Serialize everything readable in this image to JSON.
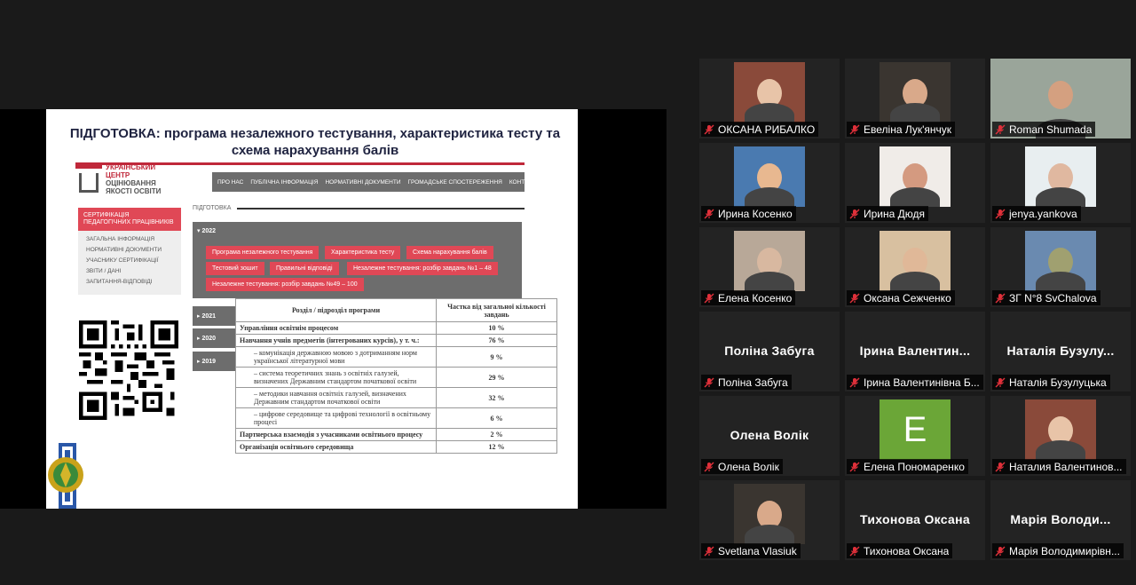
{
  "slide": {
    "title": "ПІДГОТОВКА: програма незалежного тестування, характеристика тесту та схема нарахування балів",
    "logo_lines": [
      "УКРАЇНСЬКИЙ",
      "ЦЕНТР",
      "ОЦІНЮВАННЯ",
      "ЯКОСТІ ОСВІТИ"
    ],
    "nav": [
      "ПРО НАС",
      "ПУБЛІЧНА ІНФОРМАЦІЯ",
      "НОРМАТИВНІ ДОКУМЕНТИ",
      "ГРОМАДСЬКЕ СПОСТЕРЕЖЕННЯ",
      "КОНТАКТИ"
    ],
    "left_menu_active": "СЕРТИФІКАЦІЯ ПЕДАГОГІЧНИХ ПРАЦІВНИКІВ",
    "left_menu_items": [
      "ЗАГАЛЬНА ІНФОРМАЦІЯ",
      "НОРМАТИВНІ ДОКУМЕНТИ",
      "УЧАСНИКУ СЕРТИФІКАЦІЇ",
      "ЗВІТИ / ДАНІ",
      "ЗАПИТАННЯ-ВІДПОВІДІ"
    ],
    "breadcrumb": "ПІДГОТОВКА",
    "year_open": "2022",
    "buttons": [
      "Програма незалежного тестування",
      "Характеристика тесту",
      "Схема нарахування балів",
      "Тестовий зошит",
      "Правильні відповіді",
      "Незалежне тестування: розбір завдань №1 – 48",
      "Незалежне тестування: розбір завдань №49 – 100"
    ],
    "years_closed": [
      "2021",
      "2020",
      "2019"
    ],
    "table": {
      "headers": [
        "Розділ / підрозділ програми",
        "Частка від загальної кількості завдань"
      ],
      "rows": [
        {
          "label": "Управління освітнім процесом",
          "value": "10 %",
          "style": "b"
        },
        {
          "label": "Навчання учнів предметів (інтегрованих курсів), у т. ч.:",
          "value": "76 %",
          "style": "b"
        },
        {
          "label": "– комунікація державною мовою з дотриманням норм української літературної мови",
          "value": "9 %",
          "style": "sub"
        },
        {
          "label": "– система теоретичних знань з освітніх галузей, визначених Державним стандартом початкової освіти",
          "value": "29 %",
          "style": "sub"
        },
        {
          "label": "– методики навчання освітніх галузей, визначених Державним стандартом початкової освіти",
          "value": "32 %",
          "style": "sub"
        },
        {
          "label": "– цифрове середовище та цифрові технології в освітньому процесі",
          "value": "6 %",
          "style": "sub"
        },
        {
          "label": "Партнерська взаємодія з учасниками освітнього процесу",
          "value": "2 %",
          "style": "b"
        },
        {
          "label": "Організація освітнього середовища",
          "value": "12 %",
          "style": "b"
        }
      ]
    }
  },
  "participants": [
    {
      "name": "ОКСАНА РИБАЛКО",
      "type": "video"
    },
    {
      "name": "Евеліна Лук'янчук",
      "type": "video"
    },
    {
      "name": "Roman Shumada",
      "type": "video",
      "active": true
    },
    {
      "name": "Ирина Косенко",
      "type": "video"
    },
    {
      "name": "Ирина Дюдя",
      "type": "video"
    },
    {
      "name": "jenya.yankova",
      "type": "video"
    },
    {
      "name": "Елена Косенко",
      "type": "video"
    },
    {
      "name": "Оксана Сежченко",
      "type": "video"
    },
    {
      "name": "ЗГ N°8 SvChalova",
      "type": "video"
    },
    {
      "name": "Поліна Забуга",
      "type": "name",
      "big": "Поліна Забуга"
    },
    {
      "name": "Ірина Валентинівна Б...",
      "type": "name",
      "big": "Ірина Валентин..."
    },
    {
      "name": "Наталія Бузулуцька",
      "type": "name",
      "big": "Наталія Бузулу..."
    },
    {
      "name": "Олена Волік",
      "type": "name",
      "big": "Олена Волік"
    },
    {
      "name": "Елена Пономаренко",
      "type": "letter",
      "letter": "E"
    },
    {
      "name": "Наталия Валентинов...",
      "type": "video"
    },
    {
      "name": "Svetlana Vlasiuk",
      "type": "video"
    },
    {
      "name": "Тихонова Оксана",
      "type": "name",
      "big": "Тихонова Оксана"
    },
    {
      "name": "Марія Володимирівн...",
      "type": "name",
      "big": "Марія Володи..."
    }
  ]
}
